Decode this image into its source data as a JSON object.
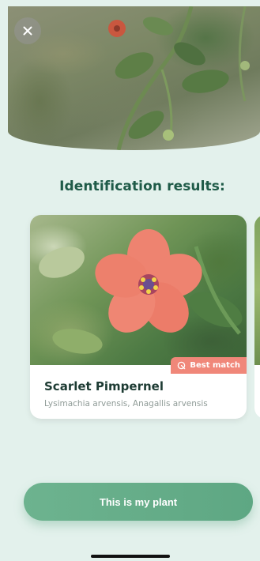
{
  "header": {
    "close_icon": "close-icon"
  },
  "title": "Identification results:",
  "results": [
    {
      "name": "Scarlet Pimpernel",
      "scientific": "Lysimachia arvensis, Anagallis arvensis",
      "badge": "Best match",
      "badge_icon": "target-leaf-icon"
    }
  ],
  "actions": {
    "confirm_label": "This is my plant"
  },
  "colors": {
    "accent_green": "#5ea783",
    "title_green": "#1f5b48",
    "badge_salmon": "#f08779",
    "background": "#e3f1ec"
  }
}
